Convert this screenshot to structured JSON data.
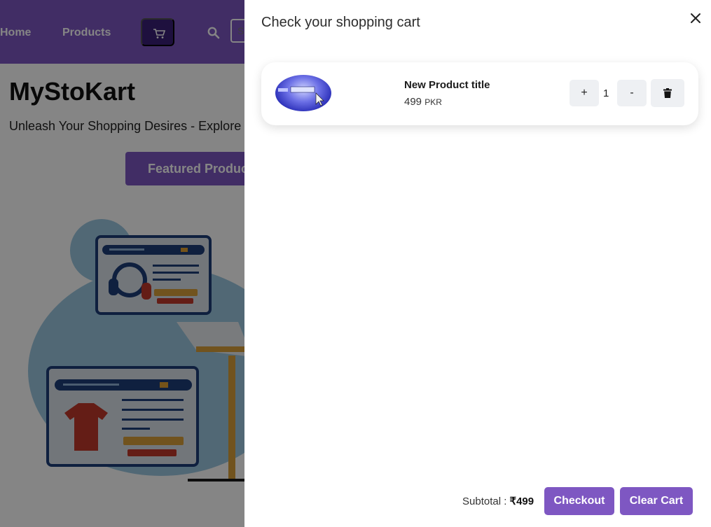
{
  "nav": {
    "home_label": "Home",
    "products_label": "Products",
    "search_placeholder": "Search"
  },
  "hero": {
    "brand_title": "MyStoKart",
    "tagline": "Unleash Your Shopping Desires - Explore Our",
    "featured_button": "Featured Products"
  },
  "cart": {
    "title": "Check your shopping cart",
    "items": [
      {
        "name": "New Product title",
        "price": "499",
        "currency": "PKR",
        "quantity": "1",
        "plus_label": "+",
        "minus_label": "-"
      }
    ],
    "subtotal_label": "Subtotal : ",
    "subtotal_value": "₹499",
    "checkout_label": "Checkout",
    "clear_label": "Clear Cart"
  },
  "colors": {
    "brand": "#7e57c2",
    "cart_button_dark": "#3a1f78",
    "qty_button_bg": "#eef0f3"
  },
  "icons": [
    "cart-icon",
    "search-icon",
    "close-icon",
    "trash-icon"
  ]
}
